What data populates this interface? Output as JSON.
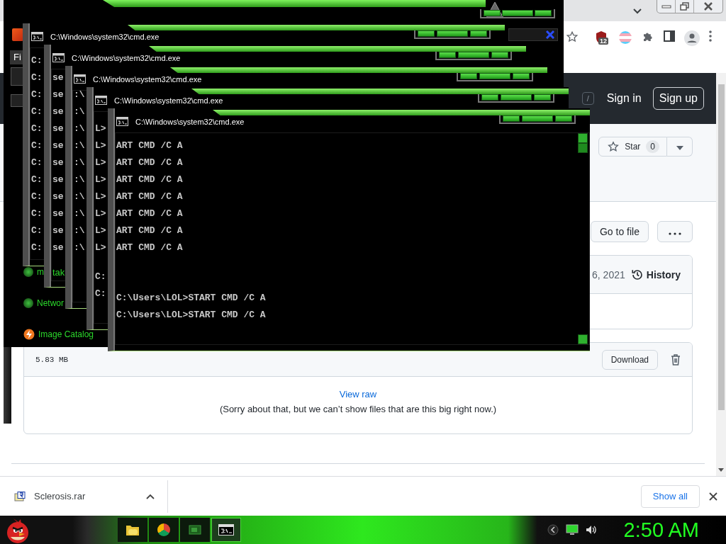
{
  "browser": {
    "extension_badge": "12",
    "github": {
      "search_key": "/",
      "sign_in": "Sign in",
      "sign_up": "Sign up",
      "star": {
        "label": "Star",
        "count": "0"
      },
      "go_to_file": "Go to file",
      "commit": {
        "date": "6, 2021",
        "history": "History"
      },
      "file": {
        "size": "5.83 MB",
        "download": "Download",
        "view_raw": "View raw",
        "message": "(Sorry about that, but we can’t show files that are this big right now.)"
      }
    },
    "downloads": {
      "items": [
        {
          "name": "Sclerosis.rar"
        }
      ],
      "show_all": "Show all"
    }
  },
  "skin_app": {
    "menu": "Fi",
    "sidebar": [
      {
        "label": "m",
        "kind": "dot"
      },
      {
        "label": "Networ",
        "kind": "dot"
      },
      {
        "label": "Image Catalog",
        "kind": "bolt"
      }
    ]
  },
  "consoles": [
    {
      "title": "C:\\Windows\\system32\\cmd.exe",
      "lines": [
        "C:",
        "C:",
        "C:",
        "C:",
        "C:",
        "C:",
        "C:",
        "C:",
        "C:",
        "C:",
        "C:",
        "C:"
      ]
    },
    {
      "title": "C:\\Windows\\system32\\cmd.exe",
      "lines": [
        "se",
        "se",
        "se",
        "se",
        "se",
        "se",
        "se",
        "se",
        "se",
        "se",
        "se"
      ],
      "overlay_text": "tak"
    },
    {
      "title": "C:\\Windows\\system32\\cmd.exe",
      "lines": [
        ":\\",
        ":\\",
        ":\\",
        ":\\",
        ":\\",
        ":\\",
        ":\\",
        ":\\",
        ":\\",
        ":\\"
      ]
    },
    {
      "title": "C:\\Windows\\system32\\cmd.exe",
      "lines": [
        "L>",
        "L>",
        "L>",
        "L>",
        "L>",
        "L>",
        "L>",
        "L>"
      ],
      "lower_lines": [
        "C:",
        "C:"
      ]
    },
    {
      "title": "C:\\Windows\\system32\\cmd.exe",
      "lines": [
        "ART CMD /C A",
        "ART CMD /C A",
        "ART CMD /C A",
        "ART CMD /C A",
        "ART CMD /C A",
        "ART CMD /C A",
        "ART CMD /C A"
      ],
      "lower_lines": [
        "C:\\Users\\LOL>START CMD /C A",
        "C:\\Users\\LOL>START CMD /C A"
      ]
    }
  ],
  "taskbar": {
    "apps": [
      {
        "kind": "folder",
        "active": false
      },
      {
        "kind": "browser",
        "active": false
      },
      {
        "kind": "window",
        "active": false
      },
      {
        "kind": "console",
        "active": true
      }
    ],
    "clock": "2:50 AM"
  }
}
